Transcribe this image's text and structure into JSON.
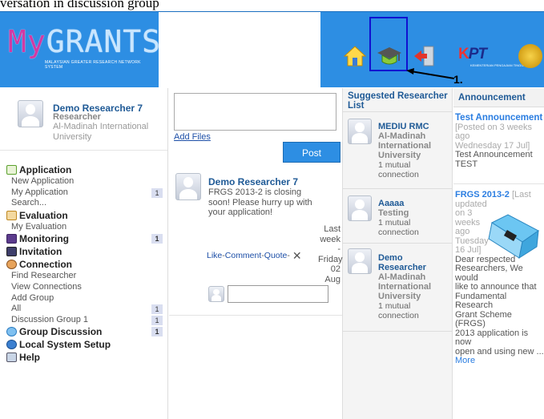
{
  "caption": "versation in discussion group",
  "header": {
    "logo_my": "My",
    "logo_rest": "GRANTS",
    "logo_subtitle": "MALAYSIAN GREATER RESEARCH NETWORK SYSTEM",
    "annotation_label": "1.",
    "kpt_k": "K",
    "kpt_text": "PT",
    "kpt_sub": "KEMENTERIAN PENGAJIAN TINGGI",
    "colors": {
      "bar": "#2d8ee3",
      "highlight": "#1010d0"
    }
  },
  "profile": {
    "name": "Demo Researcher 7",
    "role": "Researcher",
    "university_line1": "Al-Madinah International",
    "university_line2": "University"
  },
  "menu": {
    "application": "Application",
    "new_application": "New Application",
    "my_application": "My Application",
    "my_application_count": "1",
    "search": "Search...",
    "evaluation": "Evaluation",
    "my_evaluation": "My Evaluation",
    "monitoring": "Monitoring",
    "monitoring_count": "1",
    "invitation": "Invitation",
    "connection": "Connection",
    "find_researcher": "Find Researcher",
    "view_connections": "View Connections",
    "add_group": "Add Group",
    "all": "All",
    "all_count": "1",
    "discussion_group_1": "Discussion Group 1",
    "discussion_group_1_count": "1",
    "group_discussion": "Group Discussion",
    "group_discussion_count": "1",
    "local_system_setup": "Local System Setup",
    "help": "Help"
  },
  "composer": {
    "add_files": "Add Files",
    "post_label": "Post"
  },
  "feed": {
    "author": "Demo Researcher 7",
    "message": "FRGS 2013-2 is closing soon! Please hurry up with your application!",
    "like": "Like",
    "comment": "Comment",
    "quote": "Quote",
    "sep": "-",
    "time_lines": [
      "Last",
      "week",
      "- Friday",
      "02",
      "Aug"
    ]
  },
  "suggested": {
    "title": "Suggested Researcher List",
    "people": [
      {
        "name": "MEDIU RMC",
        "org": [
          "Al-Madinah",
          "International",
          "University"
        ],
        "mutual": [
          "1 mutual",
          "connection"
        ]
      },
      {
        "name": "Aaaaa",
        "org": [
          "Testing"
        ],
        "mutual": [
          "1 mutual",
          "connection"
        ]
      },
      {
        "name_lines": [
          "Demo",
          "Researcher"
        ],
        "org": [
          "Al-Madinah",
          "International",
          "University"
        ],
        "mutual": [
          "1 mutual",
          "connection"
        ]
      }
    ]
  },
  "announcement": {
    "title": "Announcement",
    "item1": {
      "title": "Test Announcement",
      "meta_lines": [
        "[Posted on 3 weeks ago",
        "Wednesday 17 Jul]"
      ],
      "body_lines": [
        "Test Announcement",
        "TEST"
      ]
    },
    "item2": {
      "title": "FRGS 2013-2",
      "meta_inline": "[Last",
      "meta_lines": [
        "updated",
        "on 3",
        "weeks",
        "ago",
        "Tuesday",
        "16 Jul]"
      ],
      "body_lines": [
        "Dear respected",
        "Researchers, We would",
        "like to announce that",
        "Fundamental Research",
        "Grant Scheme (FRGS)",
        "2013 application is now",
        "open and using new ..."
      ],
      "more": "More"
    }
  }
}
